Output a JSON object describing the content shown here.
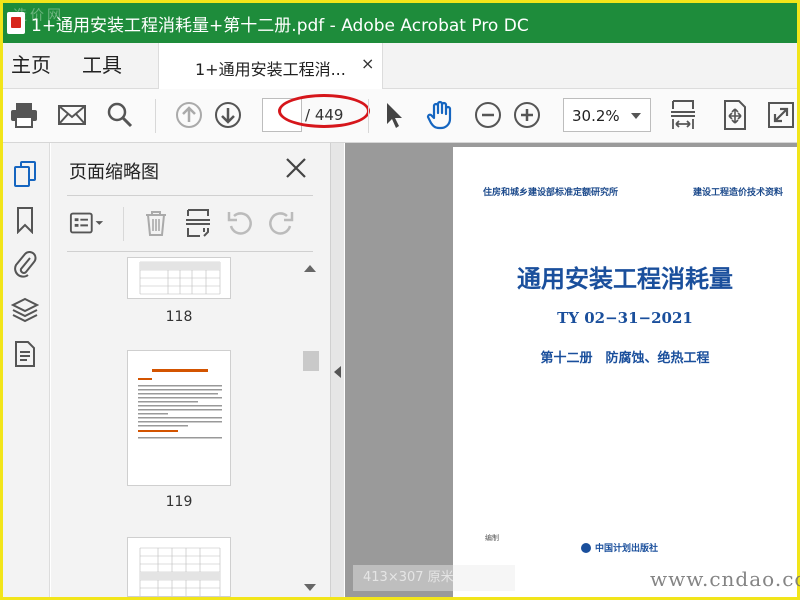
{
  "window": {
    "title": "1+通用安装工程消耗量+第十二册.pdf - Adobe Acrobat Pro DC",
    "watermark": "造价网"
  },
  "tabs": {
    "home": "主页",
    "tools": "工具",
    "doc_label": "1+通用安装工程消...",
    "close_symbol": "×"
  },
  "toolbar": {
    "icons": [
      "print-icon",
      "email-icon",
      "search-icon",
      "page-up-icon",
      "page-down-icon",
      "select-arrow-icon",
      "hand-icon",
      "zoom-out-icon",
      "zoom-in-icon",
      "fit-width-icon",
      "fit-page-icon",
      "fullscreen-icon"
    ],
    "page_current": "",
    "page_total": "/ 449",
    "zoom": "30.2%",
    "highlight_color": "#d6161b"
  },
  "thumbnail_panel": {
    "title": "页面缩略图",
    "pages": [
      {
        "label": "118"
      },
      {
        "label": "119"
      }
    ]
  },
  "cover": {
    "org_left": "住房和城乡建设部标准定额研究所",
    "org_right": "建设工程造价技术资料",
    "title": "通用安装工程消耗量",
    "code": "TY 02−31−2021",
    "subtitle": "第十二册　防腐蚀、绝热工程",
    "small_note": "编制",
    "publisher": "中国计划出版社"
  },
  "overlay": {
    "size_text": "413×307  原米"
  },
  "site_watermark": "www.cndao.com",
  "colors": {
    "titlebar": "#1e8c3b",
    "accent_blue": "#1a4f9c",
    "icon_gray": "#555555",
    "hand_blue": "#1565c0",
    "frame_yellow": "#f2e51a"
  }
}
